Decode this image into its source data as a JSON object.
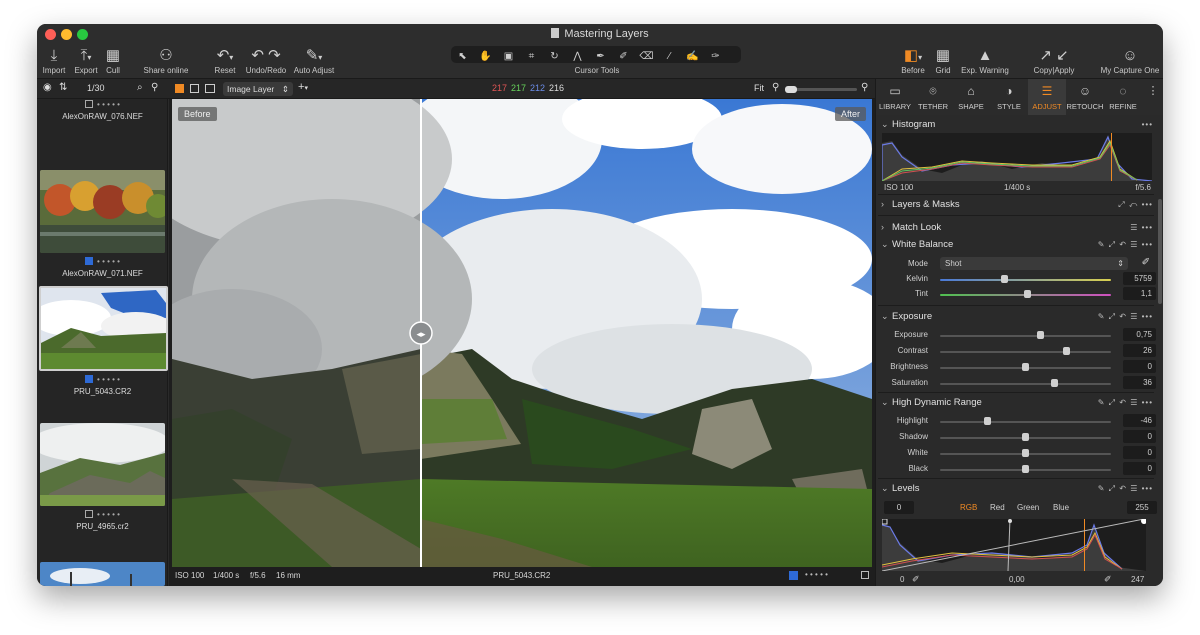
{
  "window": {
    "title": "Mastering Layers",
    "traffic_colors": [
      "#fe5f57",
      "#febc2e",
      "#28c840"
    ]
  },
  "toolbar": {
    "left": [
      {
        "label": "Import",
        "icon": "import-icon"
      },
      {
        "label": "Export",
        "icon": "export-icon"
      },
      {
        "label": "Cull",
        "icon": "cull-icon"
      },
      {
        "label": "Share online",
        "icon": "share-icon"
      },
      {
        "label": "Reset",
        "icon": "reset-icon"
      },
      {
        "label": "Undo/Redo",
        "icon": "undo-redo-icon"
      },
      {
        "label": "Auto Adjust",
        "icon": "auto-adjust-icon"
      }
    ],
    "cursor_tools_label": "Cursor Tools",
    "right": [
      {
        "label": "Before",
        "icon": "before-icon"
      },
      {
        "label": "Grid",
        "icon": "grid-icon"
      },
      {
        "label": "Exp. Warning",
        "icon": "warning-icon"
      },
      {
        "label": "Copy|Apply",
        "icon": "copy-apply-icon"
      },
      {
        "label": "My Capture One",
        "icon": "user-icon"
      }
    ]
  },
  "subbar": {
    "counter": "1/30",
    "layer_select": "Image Layer",
    "rgb": {
      "r": "217",
      "g": "217",
      "b": "212",
      "l": "216"
    },
    "zoom": "Fit"
  },
  "filmstrip": [
    {
      "name": "AlexOnRAW_076.NEF",
      "color_tag": "none",
      "stars": "• • • • •"
    },
    {
      "name": "AlexOnRAW_071.NEF",
      "color_tag": "blue",
      "stars": "• • • • •"
    },
    {
      "name": "PRU_5043.CR2",
      "color_tag": "blue",
      "stars": "• • • • •",
      "selected": true
    },
    {
      "name": "PRU_4965.cr2",
      "color_tag": "none",
      "stars": "• • • • •"
    }
  ],
  "viewer": {
    "before_label": "Before",
    "after_label": "After",
    "iso": "ISO 100",
    "shutter": "1/400 s",
    "aperture": "f/5.6",
    "focal": "16 mm",
    "filename": "PRU_5043.CR2",
    "stars": "• • • • •"
  },
  "tabs": [
    {
      "label": "LIBRARY",
      "icon": "library-icon"
    },
    {
      "label": "TETHER",
      "icon": "tether-icon"
    },
    {
      "label": "SHAPE",
      "icon": "shape-icon"
    },
    {
      "label": "STYLE",
      "icon": "style-icon"
    },
    {
      "label": "ADJUST",
      "icon": "adjust-icon",
      "active": true
    },
    {
      "label": "RETOUCH",
      "icon": "retouch-icon"
    },
    {
      "label": "REFINE",
      "icon": "refine-icon"
    }
  ],
  "histogram": {
    "title": "Histogram",
    "iso": "ISO 100",
    "shutter": "1/400 s",
    "aperture": "f/5.6"
  },
  "layers_masks": {
    "title": "Layers & Masks"
  },
  "match_look": {
    "title": "Match Look"
  },
  "white_balance": {
    "title": "White Balance",
    "mode_label": "Mode",
    "mode_value": "Shot",
    "sliders": [
      {
        "label": "Kelvin",
        "value": "5759",
        "level": 0.38
      },
      {
        "label": "Tint",
        "value": "1,1",
        "level": 0.51
      }
    ]
  },
  "exposure": {
    "title": "Exposure",
    "sliders": [
      {
        "label": "Exposure",
        "value": "0,75",
        "level": 0.59
      },
      {
        "label": "Contrast",
        "value": "26",
        "level": 0.74
      },
      {
        "label": "Brightness",
        "value": "0",
        "level": 0.5
      },
      {
        "label": "Saturation",
        "value": "36",
        "level": 0.67
      }
    ]
  },
  "hdr": {
    "title": "High Dynamic Range",
    "sliders": [
      {
        "label": "Highlight",
        "value": "-46",
        "level": 0.28
      },
      {
        "label": "Shadow",
        "value": "0",
        "level": 0.5
      },
      {
        "label": "White",
        "value": "0",
        "level": 0.5
      },
      {
        "label": "Black",
        "value": "0",
        "level": 0.5
      }
    ]
  },
  "levels": {
    "title": "Levels",
    "low": "0",
    "high": "255",
    "channels": [
      "RGB",
      "Red",
      "Green",
      "Blue"
    ],
    "active_channel": "RGB",
    "bottom_left": "0",
    "bottom_mid": "0,00",
    "bottom_right": "247"
  },
  "colors": {
    "accent": "#f08a24",
    "tag_blue": "#2e6ad6"
  }
}
